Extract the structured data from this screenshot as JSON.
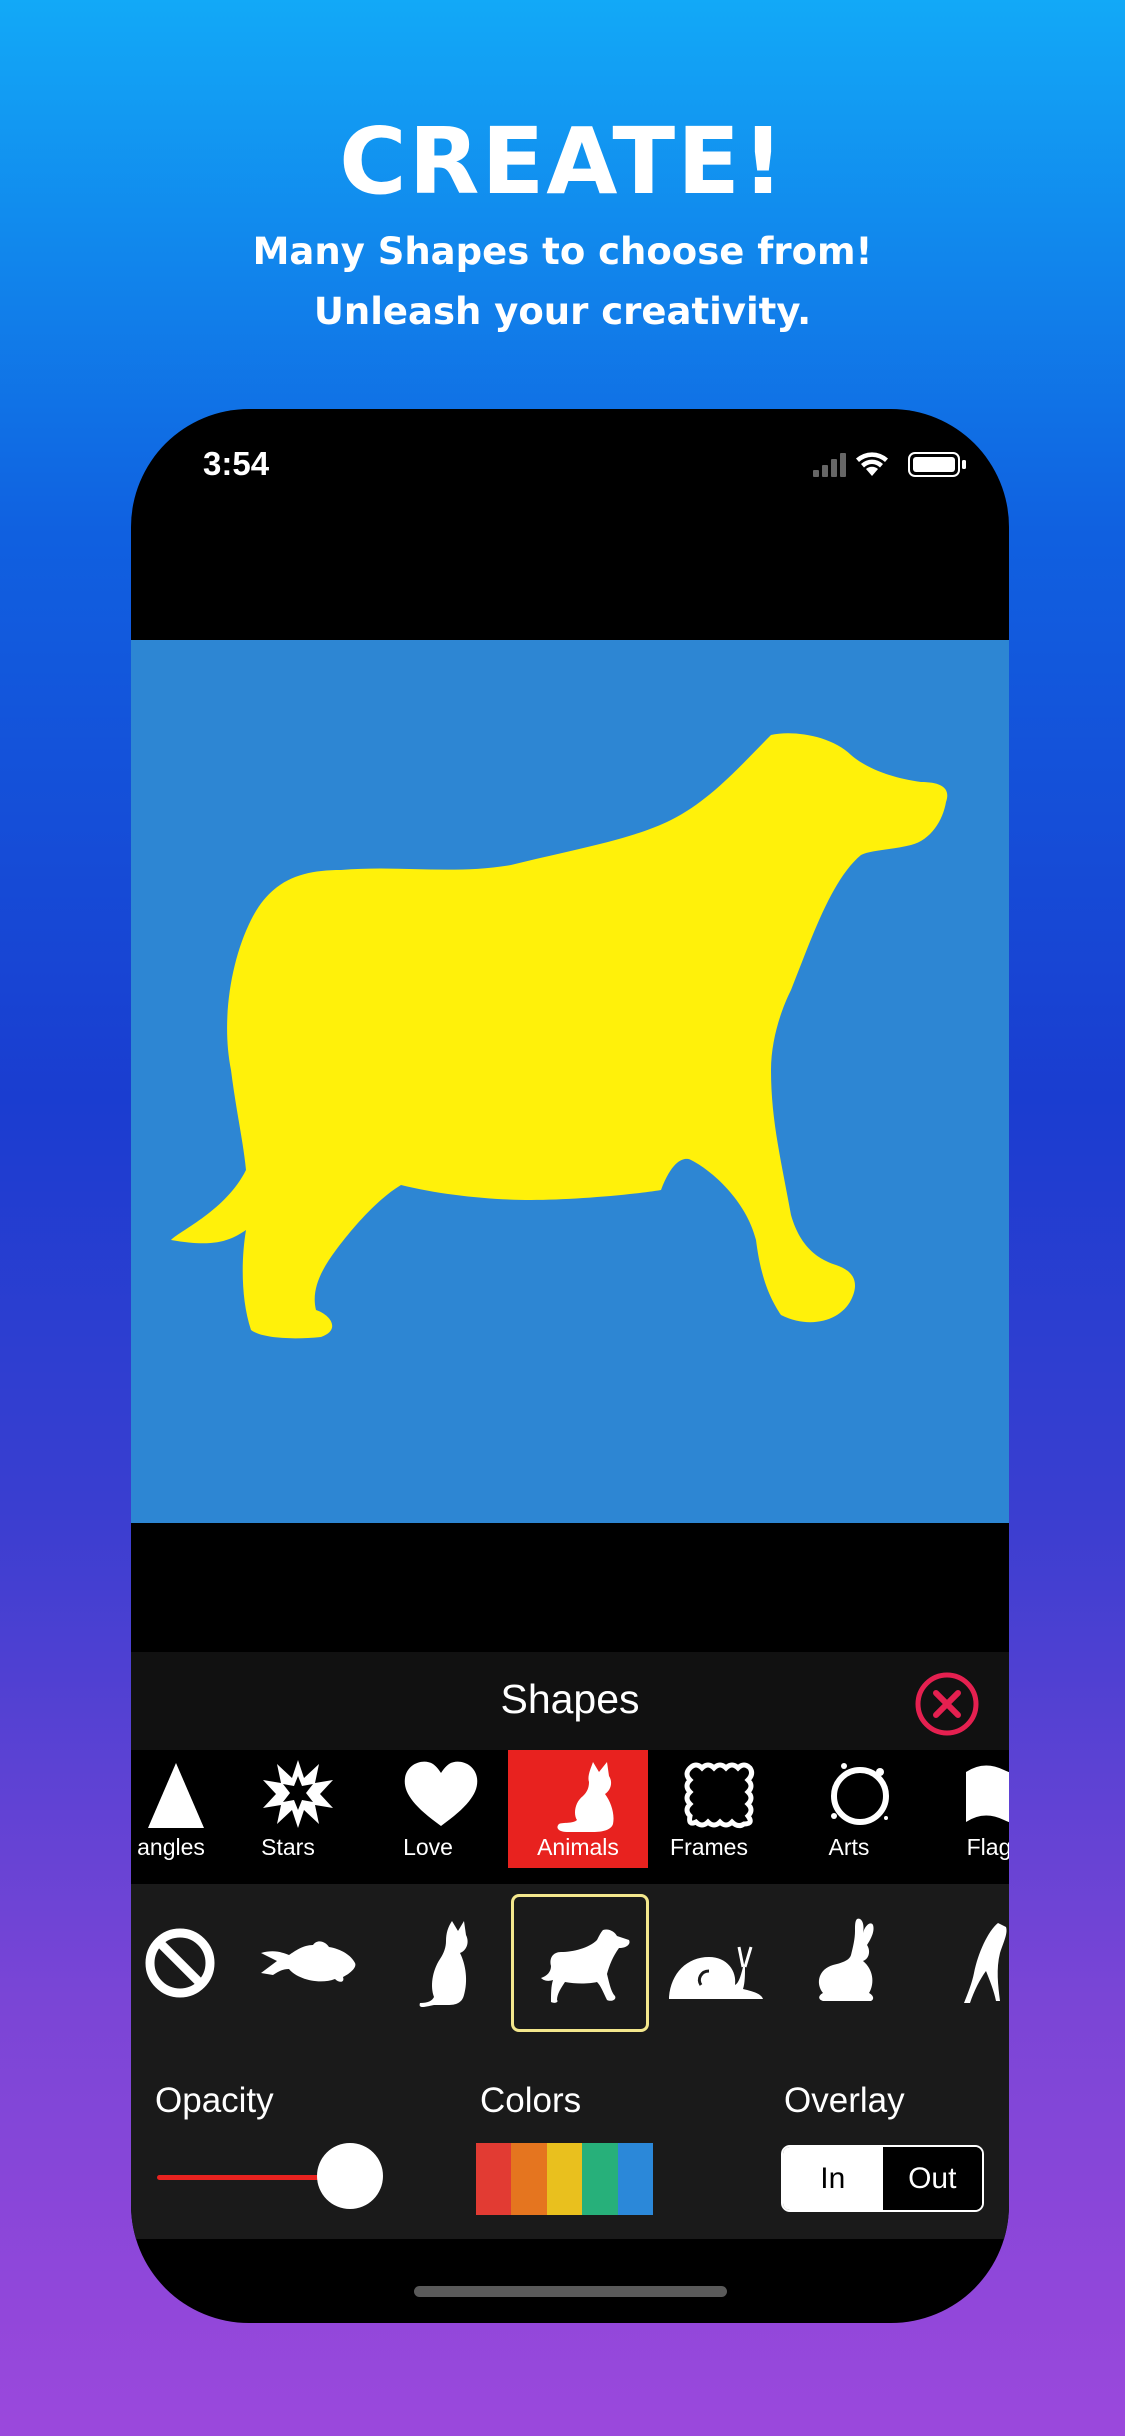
{
  "promo": {
    "headline": "CREATE!",
    "subline1": "Many Shapes to choose from!",
    "subline2": "Unleash your creativity."
  },
  "status_bar": {
    "time": "3:54",
    "icons": [
      "cellular-signal-icon",
      "wifi-icon",
      "battery-icon"
    ]
  },
  "canvas": {
    "background_color": "#2d86d3",
    "shape_color": "#fff10a",
    "shape": "dog-silhouette"
  },
  "panel": {
    "title": "Shapes",
    "close_icon": "close-circle-icon",
    "categories": [
      {
        "label": "angles",
        "icon": "triangle-icon",
        "active": false
      },
      {
        "label": "Stars",
        "icon": "starburst-icon",
        "active": false
      },
      {
        "label": "Love",
        "icon": "heart-icon",
        "active": false
      },
      {
        "label": "Animals",
        "icon": "cat-icon",
        "active": true
      },
      {
        "label": "Frames",
        "icon": "frame-icon",
        "active": false
      },
      {
        "label": "Arts",
        "icon": "ink-circle-icon",
        "active": false
      },
      {
        "label": "Flag",
        "icon": "flag-icon",
        "active": false
      }
    ],
    "shapes": [
      {
        "icon": "none-icon",
        "selected": false
      },
      {
        "icon": "fish-icon",
        "selected": false
      },
      {
        "icon": "cat-icon",
        "selected": false
      },
      {
        "icon": "dog-icon",
        "selected": true
      },
      {
        "icon": "snail-icon",
        "selected": false
      },
      {
        "icon": "rabbit-icon",
        "selected": false
      },
      {
        "icon": "bird-icon",
        "selected": false
      }
    ],
    "opacity_label": "Opacity",
    "opacity_value": 1.0,
    "colors_label": "Colors",
    "color_swatches": [
      "#e23b33",
      "#e5751f",
      "#e9c01e",
      "#27b07a",
      "#2b88d9"
    ],
    "overlay_label": "Overlay",
    "overlay_options": [
      "In",
      "Out"
    ],
    "overlay_selected": "In"
  }
}
